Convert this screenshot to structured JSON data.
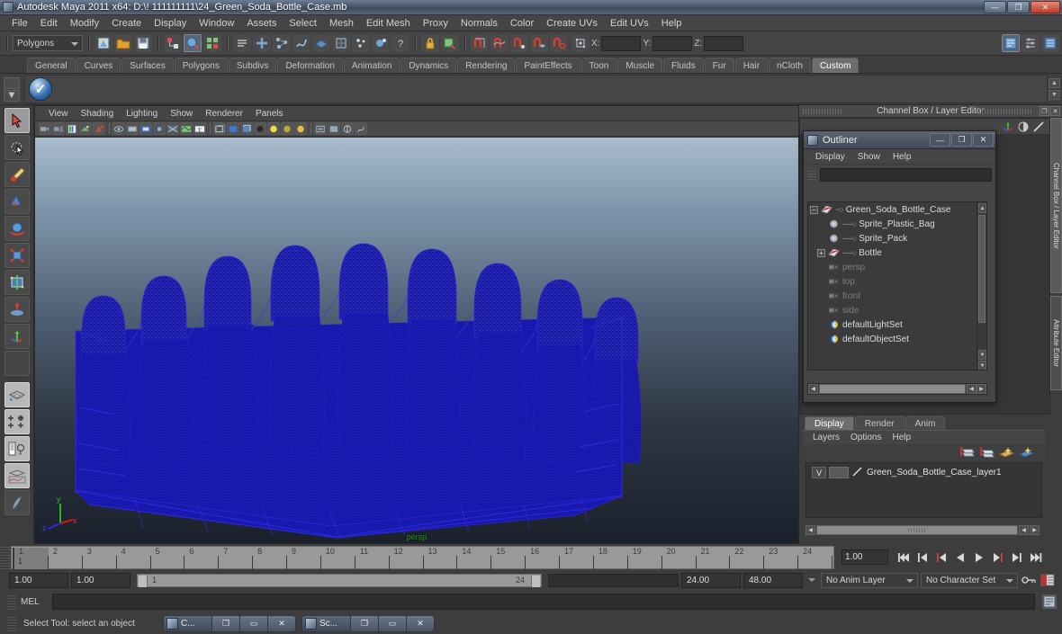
{
  "window": {
    "title": "Autodesk Maya 2011 x64: D:\\! 111111111\\24_Green_Soda_Bottle_Case.mb",
    "minimize": "—",
    "maximize": "❐",
    "close": "✕"
  },
  "menubar": {
    "items": [
      "File",
      "Edit",
      "Modify",
      "Create",
      "Display",
      "Window",
      "Assets",
      "Select",
      "Mesh",
      "Edit Mesh",
      "Proxy",
      "Normals",
      "Color",
      "Create UVs",
      "Edit UVs",
      "Help"
    ]
  },
  "statusline": {
    "menuset": "Polygons",
    "x_label": "X:",
    "y_label": "Y:",
    "z_label": "Z:",
    "x_value": "",
    "y_value": "",
    "z_value": ""
  },
  "shelf": {
    "tabs": [
      "General",
      "Curves",
      "Surfaces",
      "Polygons",
      "Subdivs",
      "Deformation",
      "Animation",
      "Dynamics",
      "Rendering",
      "PaintEffects",
      "Toon",
      "Muscle",
      "Fluids",
      "Fur",
      "Hair",
      "nCloth",
      "Custom"
    ],
    "active_tab": "Custom",
    "item_icon": "check-circle-icon"
  },
  "toolbox": {
    "tools": [
      {
        "name": "select-tool",
        "selected": true
      },
      {
        "name": "lasso-select-tool",
        "selected": false
      },
      {
        "name": "paint-selection-tool",
        "selected": false
      },
      {
        "name": "move-tool",
        "selected": false
      },
      {
        "name": "rotate-tool",
        "selected": false
      },
      {
        "name": "scale-tool",
        "selected": false
      },
      {
        "name": "universal-manipulator-tool",
        "selected": false
      },
      {
        "name": "soft-modification-tool",
        "selected": false
      },
      {
        "name": "show-manipulator-tool",
        "selected": false
      },
      {
        "name": "last-tool-used",
        "selected": false
      },
      {
        "name": "single-perspective-layout",
        "selected": false
      },
      {
        "name": "four-view-layout",
        "selected": false
      },
      {
        "name": "outliner-persp-layout",
        "selected": false
      },
      {
        "name": "persp-graph-layout",
        "selected": false
      },
      {
        "name": "paint-effects-layout",
        "selected": false
      }
    ]
  },
  "viewport": {
    "menus": [
      "View",
      "Shading",
      "Lighting",
      "Show",
      "Renderer",
      "Panels"
    ],
    "camera_label": "persp",
    "axis": {
      "x": "x",
      "y": "y",
      "z": "z"
    },
    "model": {
      "name": "Green_Soda_Bottle_Case",
      "wireframe_color": "#1f1fb4",
      "description": "Dense blue wireframe of a soda bottle case with bottles"
    }
  },
  "rightdock": {
    "title": "Channel Box / Layer Editor",
    "restore_btn": "❐",
    "close_btn": "✕",
    "side_tabs": [
      "Channel Box / Layer Editor",
      "Attribute Editor"
    ]
  },
  "outliner": {
    "title": "Outliner",
    "minimize": "—",
    "maximize": "❐",
    "close": "✕",
    "menus": [
      "Display",
      "Show",
      "Help"
    ],
    "search_value": "",
    "rows": [
      {
        "label": "Green_Soda_Bottle_Case",
        "indent": 0,
        "expander": "−",
        "icon": "transform-icon",
        "dim": false,
        "lead": "−○"
      },
      {
        "label": "Sprite_Plastic_Bag",
        "indent": 1,
        "expander": "",
        "icon": "mesh-icon",
        "dim": false,
        "lead": "──○"
      },
      {
        "label": "Sprite_Pack",
        "indent": 1,
        "expander": "",
        "icon": "mesh-icon",
        "dim": false,
        "lead": "──○"
      },
      {
        "label": "Bottle",
        "indent": 1,
        "expander": "+",
        "icon": "transform-icon",
        "dim": false,
        "lead": "──○"
      },
      {
        "label": "persp",
        "indent": 1,
        "expander": "",
        "icon": "camera-icon",
        "dim": true,
        "lead": ""
      },
      {
        "label": "top",
        "indent": 1,
        "expander": "",
        "icon": "camera-icon",
        "dim": true,
        "lead": ""
      },
      {
        "label": "front",
        "indent": 1,
        "expander": "",
        "icon": "camera-icon",
        "dim": true,
        "lead": ""
      },
      {
        "label": "side",
        "indent": 1,
        "expander": "",
        "icon": "camera-icon",
        "dim": true,
        "lead": ""
      },
      {
        "label": "defaultLightSet",
        "indent": 1,
        "expander": "",
        "icon": "set-icon",
        "dim": false,
        "lead": ""
      },
      {
        "label": "defaultObjectSet",
        "indent": 1,
        "expander": "",
        "icon": "set-icon",
        "dim": false,
        "lead": ""
      }
    ],
    "hscroll_left": "◀",
    "hscroll_right": "▶",
    "vscroll_up": "▲",
    "vscroll_down": "▼"
  },
  "layereditor": {
    "tabs": [
      "Display",
      "Render",
      "Anim"
    ],
    "active_tab": "Display",
    "menus": [
      "Layers",
      "Options",
      "Help"
    ],
    "toolbar_icons": [
      "new-layer-icon",
      "new-layer-from-selected-icon",
      "layer-options-icon",
      "layer-options2-icon"
    ],
    "layers": [
      {
        "visibility": "V",
        "type": "",
        "name": "Green_Soda_Bottle_Case_layer1"
      }
    ],
    "hscroll_left": "◀",
    "hscroll_right": "▶"
  },
  "timeslider": {
    "ticks": [
      "1",
      "2",
      "3",
      "4",
      "5",
      "6",
      "7",
      "8",
      "9",
      "10",
      "11",
      "12",
      "13",
      "14",
      "15",
      "16",
      "17",
      "18",
      "19",
      "20",
      "21",
      "22",
      "23",
      "24"
    ],
    "current_frame_marker": "1",
    "current_time_field": "1.00",
    "playback_buttons": [
      "go-to-start",
      "step-back-key",
      "step-back-frame",
      "play-backwards",
      "play-forwards",
      "step-forward-frame",
      "step-forward-key",
      "go-to-end"
    ]
  },
  "rangeslider": {
    "anim_start": "1.00",
    "range_start": "1.00",
    "range_bar_left_label": "1",
    "range_bar_right_label": "24",
    "range_end": "24.00",
    "anim_end": "48.00",
    "anim_layer": "No Anim Layer",
    "character_set": "No Character Set",
    "key_icon": "key-icon",
    "auto_key_icon": "auto-keyframe-icon",
    "anim_prefs_icon": "animation-preferences-icon"
  },
  "commandline": {
    "language": "MEL",
    "input_value": "",
    "script_editor_icon": "script-editor-icon"
  },
  "helpline": {
    "text": "Select Tool: select an object"
  },
  "taskbar": {
    "buttons": [
      {
        "label": "C...",
        "icon": "maya-window-icon",
        "restore": "❐",
        "maximize": "▭",
        "close": "✕"
      },
      {
        "label": "Sc...",
        "icon": "maya-window-icon",
        "restore": "❐",
        "maximize": "▭",
        "close": "✕"
      }
    ]
  }
}
